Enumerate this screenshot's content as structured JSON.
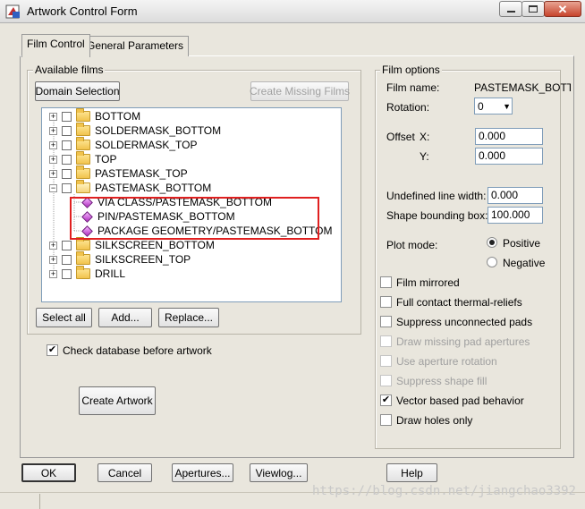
{
  "window": {
    "title": "Artwork Control Form"
  },
  "tabs": [
    {
      "label": "Film Control",
      "active": true
    },
    {
      "label": "General Parameters",
      "active": false
    }
  ],
  "available_films": {
    "legend": "Available films",
    "domain_selection": "Domain Selection",
    "create_missing": "Create Missing Films",
    "tree": [
      {
        "label": "BOTTOM",
        "level": 0,
        "expand": "+",
        "type": "folder"
      },
      {
        "label": "SOLDERMASK_BOTTOM",
        "level": 0,
        "expand": "+",
        "type": "folder"
      },
      {
        "label": "SOLDERMASK_TOP",
        "level": 0,
        "expand": "+",
        "type": "folder"
      },
      {
        "label": "TOP",
        "level": 0,
        "expand": "+",
        "type": "folder"
      },
      {
        "label": "PASTEMASK_TOP",
        "level": 0,
        "expand": "+",
        "type": "folder"
      },
      {
        "label": "PASTEMASK_BOTTOM",
        "level": 0,
        "expand": "−",
        "type": "folder-open"
      },
      {
        "label": "VIA CLASS/PASTEMASK_BOTTOM",
        "level": 1,
        "type": "item"
      },
      {
        "label": "PIN/PASTEMASK_BOTTOM",
        "level": 1,
        "type": "item"
      },
      {
        "label": "PACKAGE GEOMETRY/PASTEMASK_BOTTOM",
        "level": 1,
        "type": "item"
      },
      {
        "label": "SILKSCREEN_BOTTOM",
        "level": 0,
        "expand": "+",
        "type": "folder"
      },
      {
        "label": "SILKSCREEN_TOP",
        "level": 0,
        "expand": "+",
        "type": "folder"
      },
      {
        "label": "DRILL",
        "level": 0,
        "expand": "+",
        "type": "folder"
      }
    ],
    "select_all": "Select all",
    "add": "Add...",
    "replace": "Replace..."
  },
  "check_database": {
    "label": "Check database before artwork",
    "checked": true
  },
  "create_artwork": "Create Artwork",
  "film_options": {
    "legend": "Film options",
    "film_name_label": "Film name:",
    "film_name_value": "PASTEMASK_BOTTO",
    "rotation_label": "Rotation:",
    "rotation_value": "0",
    "offset_label": "Offset",
    "x_label": "X:",
    "x_value": "0.000",
    "y_label": "Y:",
    "y_value": "0.000",
    "undefined_line_width_label": "Undefined line width:",
    "undefined_line_width_value": "0.000",
    "shape_bounding_box_label": "Shape bounding box:",
    "shape_bounding_box_value": "100.000",
    "plot_mode_label": "Plot mode:",
    "plot_mode_options": [
      {
        "label": "Positive",
        "selected": true
      },
      {
        "label": "Negative",
        "selected": false
      }
    ],
    "checkboxes": [
      {
        "label": "Film mirrored",
        "checked": false,
        "enabled": true
      },
      {
        "label": "Full contact thermal-reliefs",
        "checked": false,
        "enabled": true
      },
      {
        "label": "Suppress unconnected pads",
        "checked": false,
        "enabled": true
      },
      {
        "label": "Draw missing pad apertures",
        "checked": false,
        "enabled": false
      },
      {
        "label": "Use aperture rotation",
        "checked": false,
        "enabled": false
      },
      {
        "label": "Suppress shape fill",
        "checked": false,
        "enabled": false
      },
      {
        "label": "Vector based pad behavior",
        "checked": true,
        "enabled": true
      },
      {
        "label": "Draw holes only",
        "checked": false,
        "enabled": true
      }
    ]
  },
  "footer": {
    "ok": "OK",
    "cancel": "Cancel",
    "apertures": "Apertures...",
    "viewlog": "Viewlog...",
    "help": "Help"
  },
  "watermark": "https://blog.csdn.net/jiangchao3392",
  "colors": {
    "highlight_box": "#e02020",
    "dialog_bg": "#e9e6dd"
  }
}
